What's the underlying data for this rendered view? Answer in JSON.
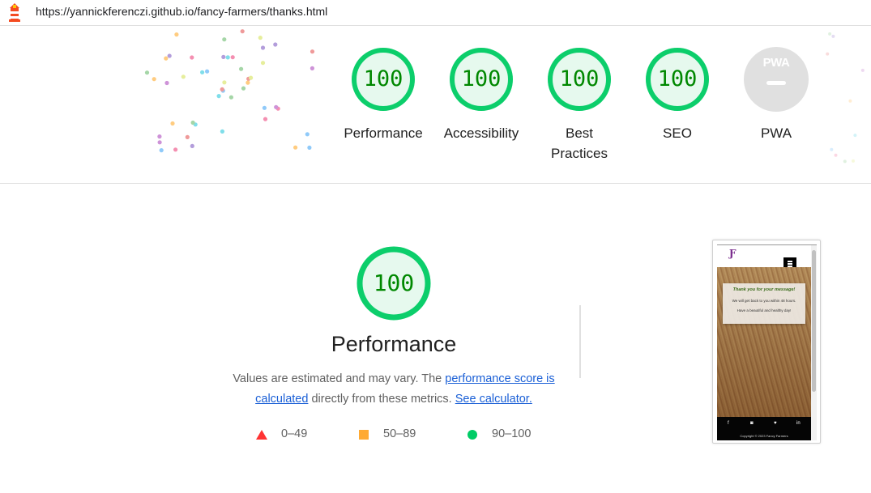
{
  "browser": {
    "url": "https://yannickferenczi.github.io/fancy-farmers/thanks.html"
  },
  "summary_gauges": [
    {
      "label": "Performance",
      "score": "100"
    },
    {
      "label": "Accessibility",
      "score": "100"
    },
    {
      "label": "Best Practices",
      "score": "100"
    },
    {
      "label": "SEO",
      "score": "100"
    }
  ],
  "pwa": {
    "badge_text": "PWA",
    "label": "PWA"
  },
  "performance": {
    "score": "100",
    "title": "Performance",
    "desc_prefix": "Values are estimated and may vary. The ",
    "link_score": "performance score is calculated",
    "desc_middle": " directly from these metrics. ",
    "link_calc": "See calculator."
  },
  "legend": [
    {
      "shape": "triangle",
      "color": "#ff3333",
      "range": "0–49"
    },
    {
      "shape": "square",
      "color": "#ffaa33",
      "range": "50–89"
    },
    {
      "shape": "circle",
      "color": "#00cc66",
      "range": "90–100"
    }
  ],
  "thumbnail": {
    "logo": "Ƒ",
    "heading": "Thank you for your message!",
    "line1": "We will get back to you within 48 hours.",
    "line2": "Have a beautiful and healthy day!",
    "footer_icons": [
      "f",
      "◙",
      "♥",
      "in"
    ],
    "copyright": "Copyright © 2023 Fancy Farmers"
  },
  "colors": {
    "pass_green": "#0cce6b",
    "pass_fill": "#e6f9ee",
    "score_text": "#008800",
    "link": "#1a5fd6"
  }
}
